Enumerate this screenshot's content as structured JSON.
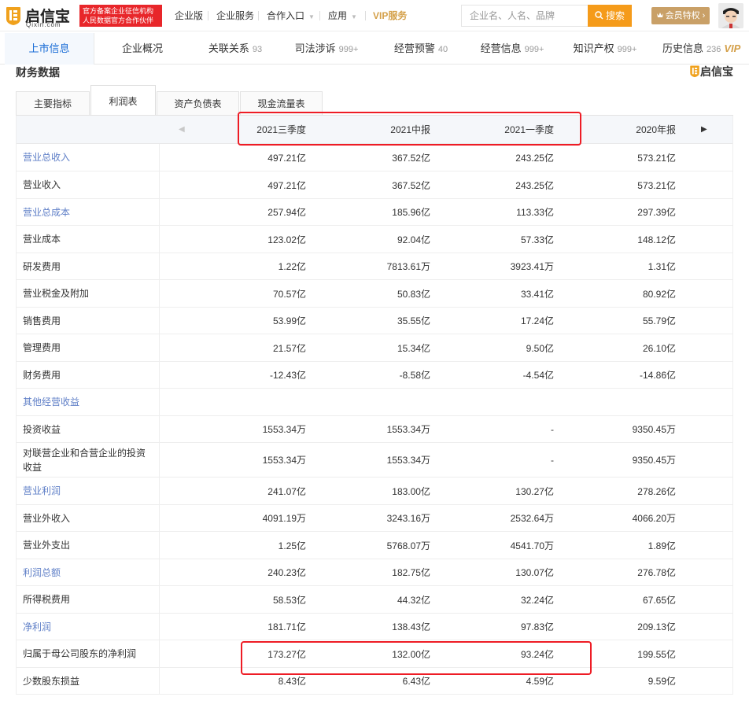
{
  "header": {
    "logo_text": "启信宝",
    "logo_sub": "Qixin.com",
    "badge_line1": "官方备案企业征信机构",
    "badge_line2": "人民数据官方合作伙伴",
    "nav": [
      "企业版",
      "企业服务",
      "合作入口",
      "应用"
    ],
    "vip_label": "VIP服务",
    "search_placeholder": "企业名、人名、品牌",
    "search_button": "搜索",
    "member_button": "会员特权",
    "accent_color": "#f59b1a",
    "brand_red": "#e8262a"
  },
  "tabs": [
    {
      "label": "上市信息",
      "count": ""
    },
    {
      "label": "企业概况",
      "count": ""
    },
    {
      "label": "关联关系",
      "count": "93"
    },
    {
      "label": "司法涉诉",
      "count": "999+"
    },
    {
      "label": "经营预警",
      "count": "40"
    },
    {
      "label": "经营信息",
      "count": "999+"
    },
    {
      "label": "知识产权",
      "count": "999+"
    },
    {
      "label": "历史信息",
      "count": "236"
    }
  ],
  "section": {
    "title": "财务数据",
    "brand": "启信宝"
  },
  "subtabs": [
    "主要指标",
    "利润表",
    "资产负债表",
    "现金流量表"
  ],
  "table": {
    "periods": [
      "2021三季度",
      "2021中报",
      "2021一季度",
      "2020年报"
    ],
    "rows": [
      {
        "label": "营业总收入",
        "blue": true,
        "values": [
          "497.21亿",
          "367.52亿",
          "243.25亿",
          "573.21亿"
        ]
      },
      {
        "label": "营业收入",
        "blue": false,
        "values": [
          "497.21亿",
          "367.52亿",
          "243.25亿",
          "573.21亿"
        ]
      },
      {
        "label": "营业总成本",
        "blue": true,
        "values": [
          "257.94亿",
          "185.96亿",
          "113.33亿",
          "297.39亿"
        ]
      },
      {
        "label": "营业成本",
        "blue": false,
        "values": [
          "123.02亿",
          "92.04亿",
          "57.33亿",
          "148.12亿"
        ]
      },
      {
        "label": "研发费用",
        "blue": false,
        "values": [
          "1.22亿",
          "7813.61万",
          "3923.41万",
          "1.31亿"
        ]
      },
      {
        "label": "营业税金及附加",
        "blue": false,
        "values": [
          "70.57亿",
          "50.83亿",
          "33.41亿",
          "80.92亿"
        ]
      },
      {
        "label": "销售费用",
        "blue": false,
        "values": [
          "53.99亿",
          "35.55亿",
          "17.24亿",
          "55.79亿"
        ]
      },
      {
        "label": "管理费用",
        "blue": false,
        "values": [
          "21.57亿",
          "15.34亿",
          "9.50亿",
          "26.10亿"
        ]
      },
      {
        "label": "财务费用",
        "blue": false,
        "values": [
          "-12.43亿",
          "-8.58亿",
          "-4.54亿",
          "-14.86亿"
        ]
      },
      {
        "label": "其他经营收益",
        "blue": true,
        "values": [
          "",
          "",
          "",
          ""
        ]
      },
      {
        "label": "投资收益",
        "blue": false,
        "values": [
          "1553.34万",
          "1553.34万",
          "-",
          "9350.45万"
        ]
      },
      {
        "label": "对联营企业和合营企业的投资收益",
        "blue": false,
        "values": [
          "1553.34万",
          "1553.34万",
          "-",
          "9350.45万"
        ]
      },
      {
        "label": "营业利润",
        "blue": true,
        "values": [
          "241.07亿",
          "183.00亿",
          "130.27亿",
          "278.26亿"
        ]
      },
      {
        "label": "营业外收入",
        "blue": false,
        "values": [
          "4091.19万",
          "3243.16万",
          "2532.64万",
          "4066.20万"
        ]
      },
      {
        "label": "营业外支出",
        "blue": false,
        "values": [
          "1.25亿",
          "5768.07万",
          "4541.70万",
          "1.89亿"
        ]
      },
      {
        "label": "利润总额",
        "blue": true,
        "values": [
          "240.23亿",
          "182.75亿",
          "130.07亿",
          "276.78亿"
        ]
      },
      {
        "label": "所得税费用",
        "blue": false,
        "values": [
          "58.53亿",
          "44.32亿",
          "32.24亿",
          "67.65亿"
        ]
      },
      {
        "label": "净利润",
        "blue": true,
        "values": [
          "181.71亿",
          "138.43亿",
          "97.83亿",
          "209.13亿"
        ]
      },
      {
        "label": "归属于母公司股东的净利润",
        "blue": false,
        "values": [
          "173.27亿",
          "132.00亿",
          "93.24亿",
          "199.55亿"
        ]
      },
      {
        "label": "少数股东损益",
        "blue": false,
        "values": [
          "8.43亿",
          "6.43亿",
          "4.59亿",
          "9.59亿"
        ]
      }
    ]
  }
}
